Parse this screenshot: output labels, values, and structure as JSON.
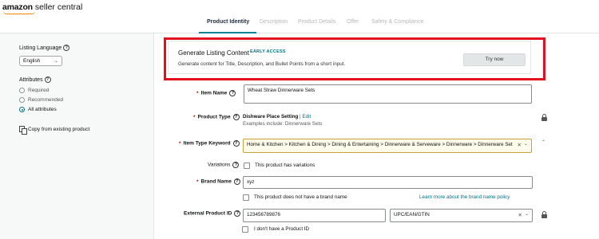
{
  "header": {
    "logo_brand": "amazon",
    "logo_rest": " seller central"
  },
  "tabs": [
    {
      "label": "Product Identity",
      "active": true
    },
    {
      "label": "Description",
      "active": false
    },
    {
      "label": "Product Details",
      "active": false
    },
    {
      "label": "Offer",
      "active": false
    },
    {
      "label": "Safety & Compliance",
      "active": false
    }
  ],
  "sidebar": {
    "language_label": "Listing Language",
    "language_value": "English",
    "attributes_label": "Attributes",
    "attribute_options": [
      {
        "label": "Required",
        "checked": false
      },
      {
        "label": "Recommended",
        "checked": false
      },
      {
        "label": "All attributes",
        "checked": true
      }
    ],
    "copy_label": "Copy from existing product"
  },
  "generate": {
    "title": "Generate Listing Content",
    "badge": "EARLY ACCESS",
    "description": "Generate content for Title, Description, and Bullet Points from a short input.",
    "button": "Try now"
  },
  "form": {
    "item_name_label": "Item Name",
    "item_name_value": "Wheat Straw Dinnerware Sets",
    "product_type_label": "Product Type",
    "product_type_value": "Dishware Place Setting",
    "product_type_edit": "Edit",
    "product_type_examples": "Examples include: Dinnerware Sets",
    "keyword_label": "Item Type Keyword",
    "keyword_value": "Home & Kitchen > Kitchen & Dining > Dining & Entertaining > Dinnerware & Serveware > Dinnerware > Dinnerware Set",
    "variations_label": "Variations",
    "variations_checkbox": "This product has variations",
    "brand_label": "Brand Name",
    "brand_value": "xyz",
    "no_brand_checkbox": "This product does not have a brand name",
    "brand_policy_link": "Learn more about the brand name policy",
    "external_id_label": "External Product ID",
    "external_id_value": "123456789876",
    "external_id_type": "UPC/EAN/GTIN",
    "no_product_id_checkbox": "I don't have a Product ID"
  },
  "colors": {
    "accent": "#007185",
    "highlight": "#e3101f",
    "tab_underline": "#008296"
  }
}
